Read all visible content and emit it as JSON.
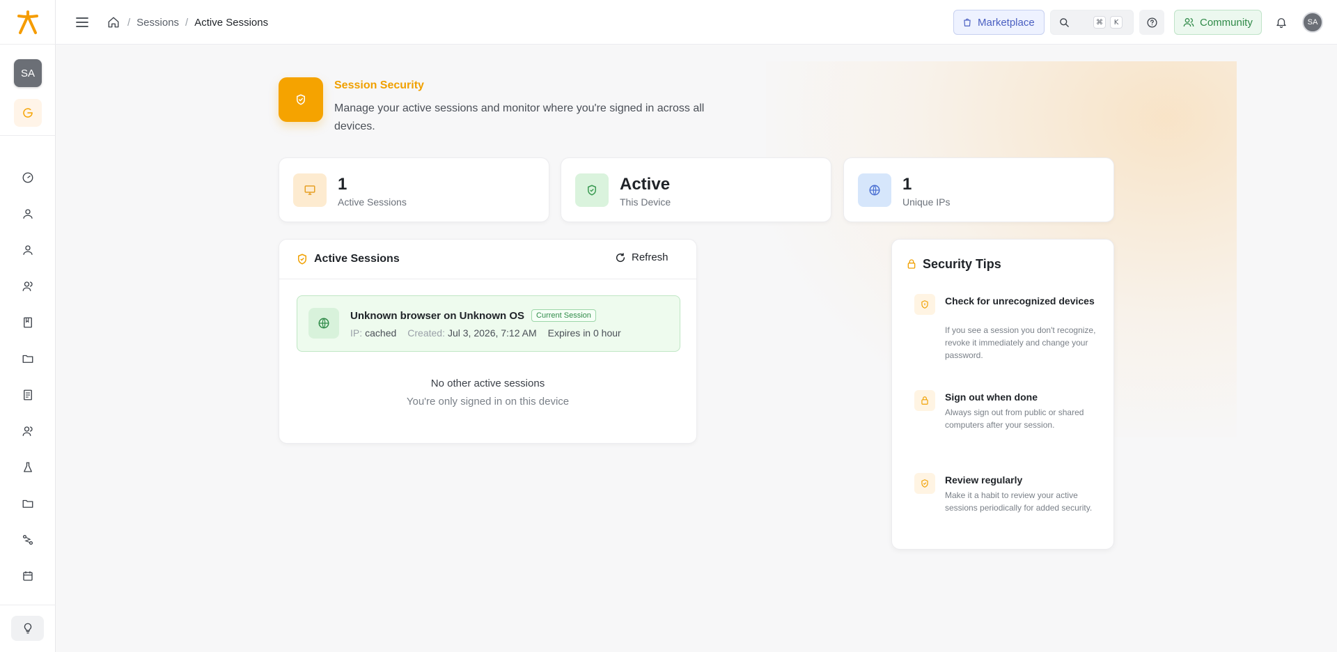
{
  "sidebar": {
    "workspace_initials": "SA",
    "nav_icons": [
      "dashboard-icon",
      "user-icon",
      "profile-icon",
      "team-icon",
      "book-icon",
      "folder-icon",
      "report-icon",
      "users-icon",
      "flask-icon",
      "folder-icon",
      "route-icon",
      "calendar-icon"
    ],
    "bottom_icon": "lightbulb-icon"
  },
  "topbar": {
    "breadcrumb": [
      "Sessions",
      "Active Sessions"
    ],
    "marketplace_label": "Marketplace",
    "search_kbd": [
      "⌘",
      "K"
    ],
    "community_label": "Community",
    "user_initials": "SA"
  },
  "header": {
    "title": "Session Security",
    "description": "Manage your active sessions and monitor where you're signed in across all devices."
  },
  "stats": [
    {
      "value": "1",
      "label": "Active Sessions",
      "icon": "monitor-icon"
    },
    {
      "value": "Active",
      "label": "This Device",
      "icon": "shield-icon"
    },
    {
      "value": "1",
      "label": "Unique IPs",
      "icon": "globe-icon"
    }
  ],
  "sessions": {
    "title": "Active Sessions",
    "refresh_label": "Refresh",
    "current": {
      "name": "Unknown browser on Unknown OS",
      "badge": "Current Session",
      "ip_label": "IP:",
      "ip": "cached",
      "created_label": "Created:",
      "created": "Jul 3, 2026, 7:12 AM",
      "expires": "Expires in 0 hour"
    },
    "empty_title": "No other active sessions",
    "empty_subtitle": "You're only signed in on this device"
  },
  "tips": {
    "title": "Security Tips",
    "items": [
      {
        "title": "Check for unrecognized devices",
        "description": "If you see a session you don't recognize, revoke it immediately and change your password."
      },
      {
        "title": "Sign out when done",
        "description": "Always sign out from public or shared computers after your session."
      },
      {
        "title": "Review regularly",
        "description": "Make it a habit to review your active sessions periodically for added security."
      }
    ]
  },
  "colors": {
    "accent": "#f5a300",
    "success": "#2f8a48",
    "info": "#4a5fc1"
  }
}
